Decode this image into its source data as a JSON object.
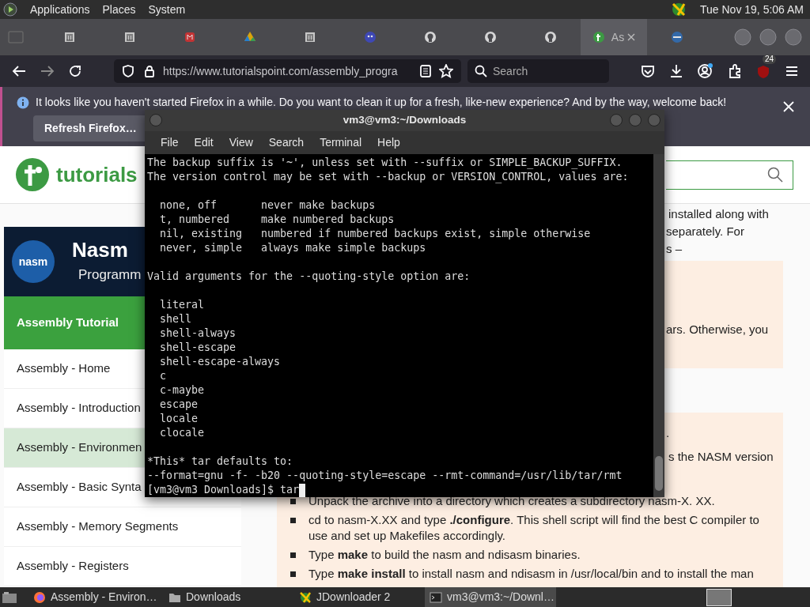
{
  "top_panel": {
    "menus": [
      "Applications",
      "Places",
      "System"
    ],
    "clock": "Tue Nov 19, 5:06 AM"
  },
  "browser": {
    "tabs": [
      {
        "selected": false
      },
      {
        "selected": false
      },
      {
        "selected": false
      },
      {
        "selected": false
      },
      {
        "selected": false
      },
      {
        "selected": false
      },
      {
        "selected": false
      },
      {
        "selected": false
      },
      {
        "selected": false
      },
      {
        "selected": true,
        "label": "As"
      },
      {
        "selected": false
      }
    ],
    "url": "https://www.tutorialspoint.com/assembly_progra",
    "search": {
      "placeholder": "Search"
    },
    "extension_badge": "24",
    "notification": {
      "text": "It looks like you haven't started Firefox in a while. Do you want to clean it up for a fresh, like-new experience? And by the way, welcome back!",
      "button": "Refresh Firefox…"
    }
  },
  "page": {
    "logo": "tutorials",
    "banner": {
      "logo": "nasm",
      "title": "Nasm",
      "subtitle": "Programm"
    },
    "sidebar": {
      "heading": "Assembly Tutorial",
      "items": [
        {
          "label": "Assembly - Home",
          "selected": false
        },
        {
          "label": "Assembly - Introduction",
          "selected": false
        },
        {
          "label": "Assembly - Environmen",
          "selected": true
        },
        {
          "label": "Assembly - Basic Synta",
          "selected": false
        },
        {
          "label": "Assembly - Memory Segments",
          "selected": false
        },
        {
          "label": "Assembly - Registers",
          "selected": false
        }
      ]
    },
    "intro_lines": [
      "installed along with",
      "separately. For",
      "s –"
    ],
    "note_1": "ars. Otherwise, you",
    "note_2_lines": [
      ".",
      "s the NASM version"
    ],
    "steps": [
      "Unpack the archive into a directory which creates a subdirectory nasm-X. XX.",
      "cd to nasm-X.XX and type **./configure**. This shell script will find the best C compiler to use and set up Makefiles accordingly.",
      "Type **make** to build the nasm and ndisasm binaries.",
      "Type **make install** to install nasm and ndisasm in /usr/local/bin and to install the man"
    ]
  },
  "terminal": {
    "title": "vm3@vm3:~/Downloads",
    "menu": [
      "File",
      "Edit",
      "View",
      "Search",
      "Terminal",
      "Help"
    ],
    "blocks": [
      [
        "The backup suffix is '~', unless set with --suffix or SIMPLE_BACKUP_SUFFIX.",
        "The version control may be set with --backup or VERSION_CONTROL, values are:"
      ],
      [
        "  none, off       never make backups",
        "  t, numbered     make numbered backups",
        "  nil, existing   numbered if numbered backups exist, simple otherwise",
        "  never, simple   always make simple backups"
      ],
      [
        "Valid arguments for the --quoting-style option are:"
      ],
      [
        "  literal",
        "  shell",
        "  shell-always",
        "  shell-escape",
        "  shell-escape-always",
        "  c",
        "  c-maybe",
        "  escape",
        "  locale",
        "  clocale"
      ],
      [
        "*This* tar defaults to:",
        "--format=gnu -f- -b20 --quoting-style=escape --rmt-command=/usr/lib/tar/rmt"
      ]
    ],
    "prompt": "[vm3@vm3 Downloads]$ tar"
  },
  "taskbar": [
    {
      "label": "Assembly - Environ…",
      "selected": false,
      "kind": "browser"
    },
    {
      "label": "Downloads",
      "selected": false,
      "kind": "folder"
    },
    {
      "label": "JDownloader 2",
      "selected": false,
      "kind": "app"
    },
    {
      "label": "vm3@vm3:~/Downl…",
      "selected": true,
      "kind": "terminal"
    }
  ]
}
